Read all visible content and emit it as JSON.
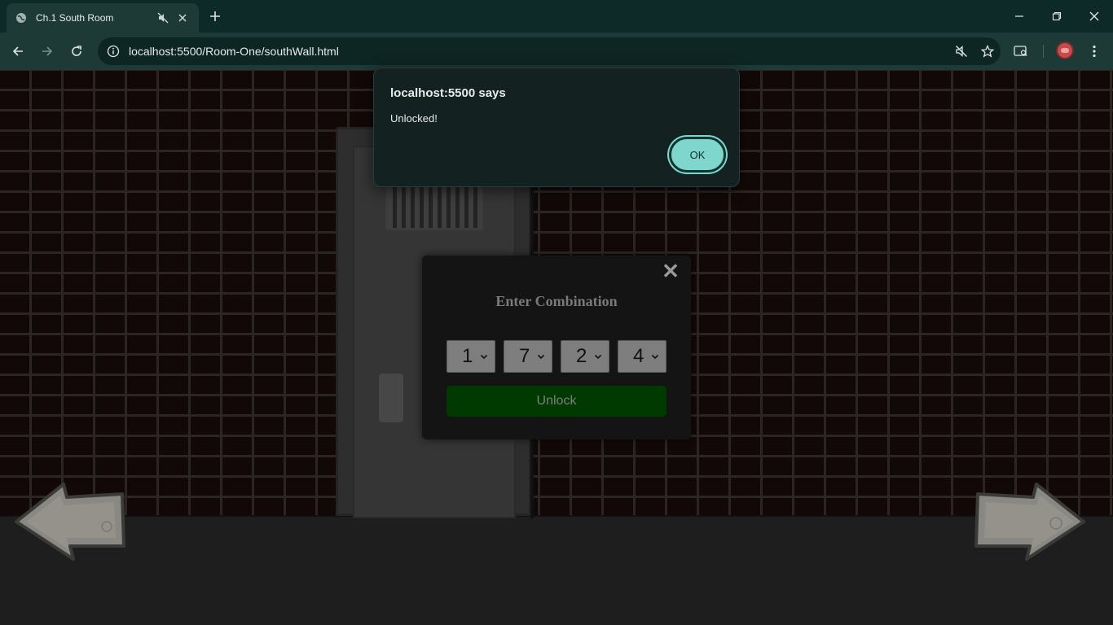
{
  "browser": {
    "tab_title": "Ch.1 South Room",
    "url": "localhost:5500/Room-One/southWall.html",
    "accent_color": "#7fd6cc",
    "icons": [
      "globe-icon",
      "mute-icon",
      "close-icon",
      "plus-icon",
      "back-icon",
      "forward-icon",
      "reload-icon",
      "site-info-icon",
      "star-icon",
      "tab-search-icon",
      "profile-avatar",
      "menu-icon"
    ]
  },
  "alert": {
    "origin": "localhost:5500 says",
    "message": "Unlocked!",
    "ok_label": "OK"
  },
  "modal": {
    "close_label": "✕",
    "heading": "Enter Combination",
    "dials": [
      "1",
      "7",
      "2",
      "4"
    ],
    "unlock_label": "Unlock"
  },
  "scene": {
    "navigation": [
      "left-arrow-stone",
      "right-arrow-stone"
    ]
  }
}
